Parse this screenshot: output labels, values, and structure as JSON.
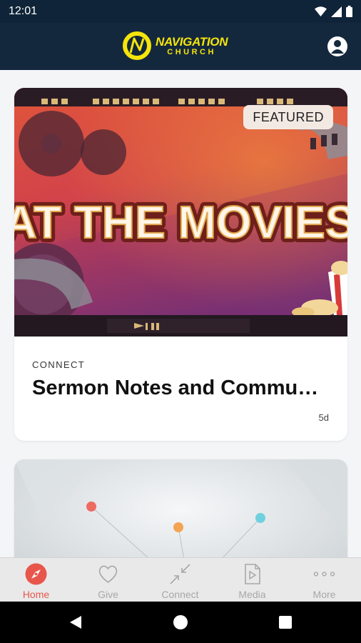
{
  "status_bar": {
    "time": "12:01",
    "icons": [
      "wifi-icon",
      "signal-icon",
      "battery-icon"
    ]
  },
  "header": {
    "logo_line1": "NAVIGATION",
    "logo_line2": "CHURCH",
    "brand_color": "#f5e50a",
    "background": "#14283d",
    "profile_icon": "profile-icon"
  },
  "feed": {
    "cards": [
      {
        "badge": "FEATURED",
        "hero_title": "AT THE MOVIES",
        "category": "CONNECT",
        "title": "Sermon Notes and Commu…",
        "age": "5d"
      },
      {
        "hero_icons": [
          "dot-red",
          "dot-orange",
          "dot-teal"
        ]
      }
    ]
  },
  "tab_bar": {
    "accent": "#e8564b",
    "inactive_color": "#a7a7a7",
    "tabs": [
      {
        "label": "Home",
        "icon": "compass-icon",
        "active": true
      },
      {
        "label": "Give",
        "icon": "heart-icon",
        "active": false
      },
      {
        "label": "Connect",
        "icon": "arrows-in-icon",
        "active": false
      },
      {
        "label": "Media",
        "icon": "media-file-icon",
        "active": false
      },
      {
        "label": "More",
        "icon": "more-dots-icon",
        "active": false
      }
    ]
  },
  "nav_bar": {
    "icons": [
      "back-icon",
      "home-icon",
      "recents-icon"
    ]
  }
}
